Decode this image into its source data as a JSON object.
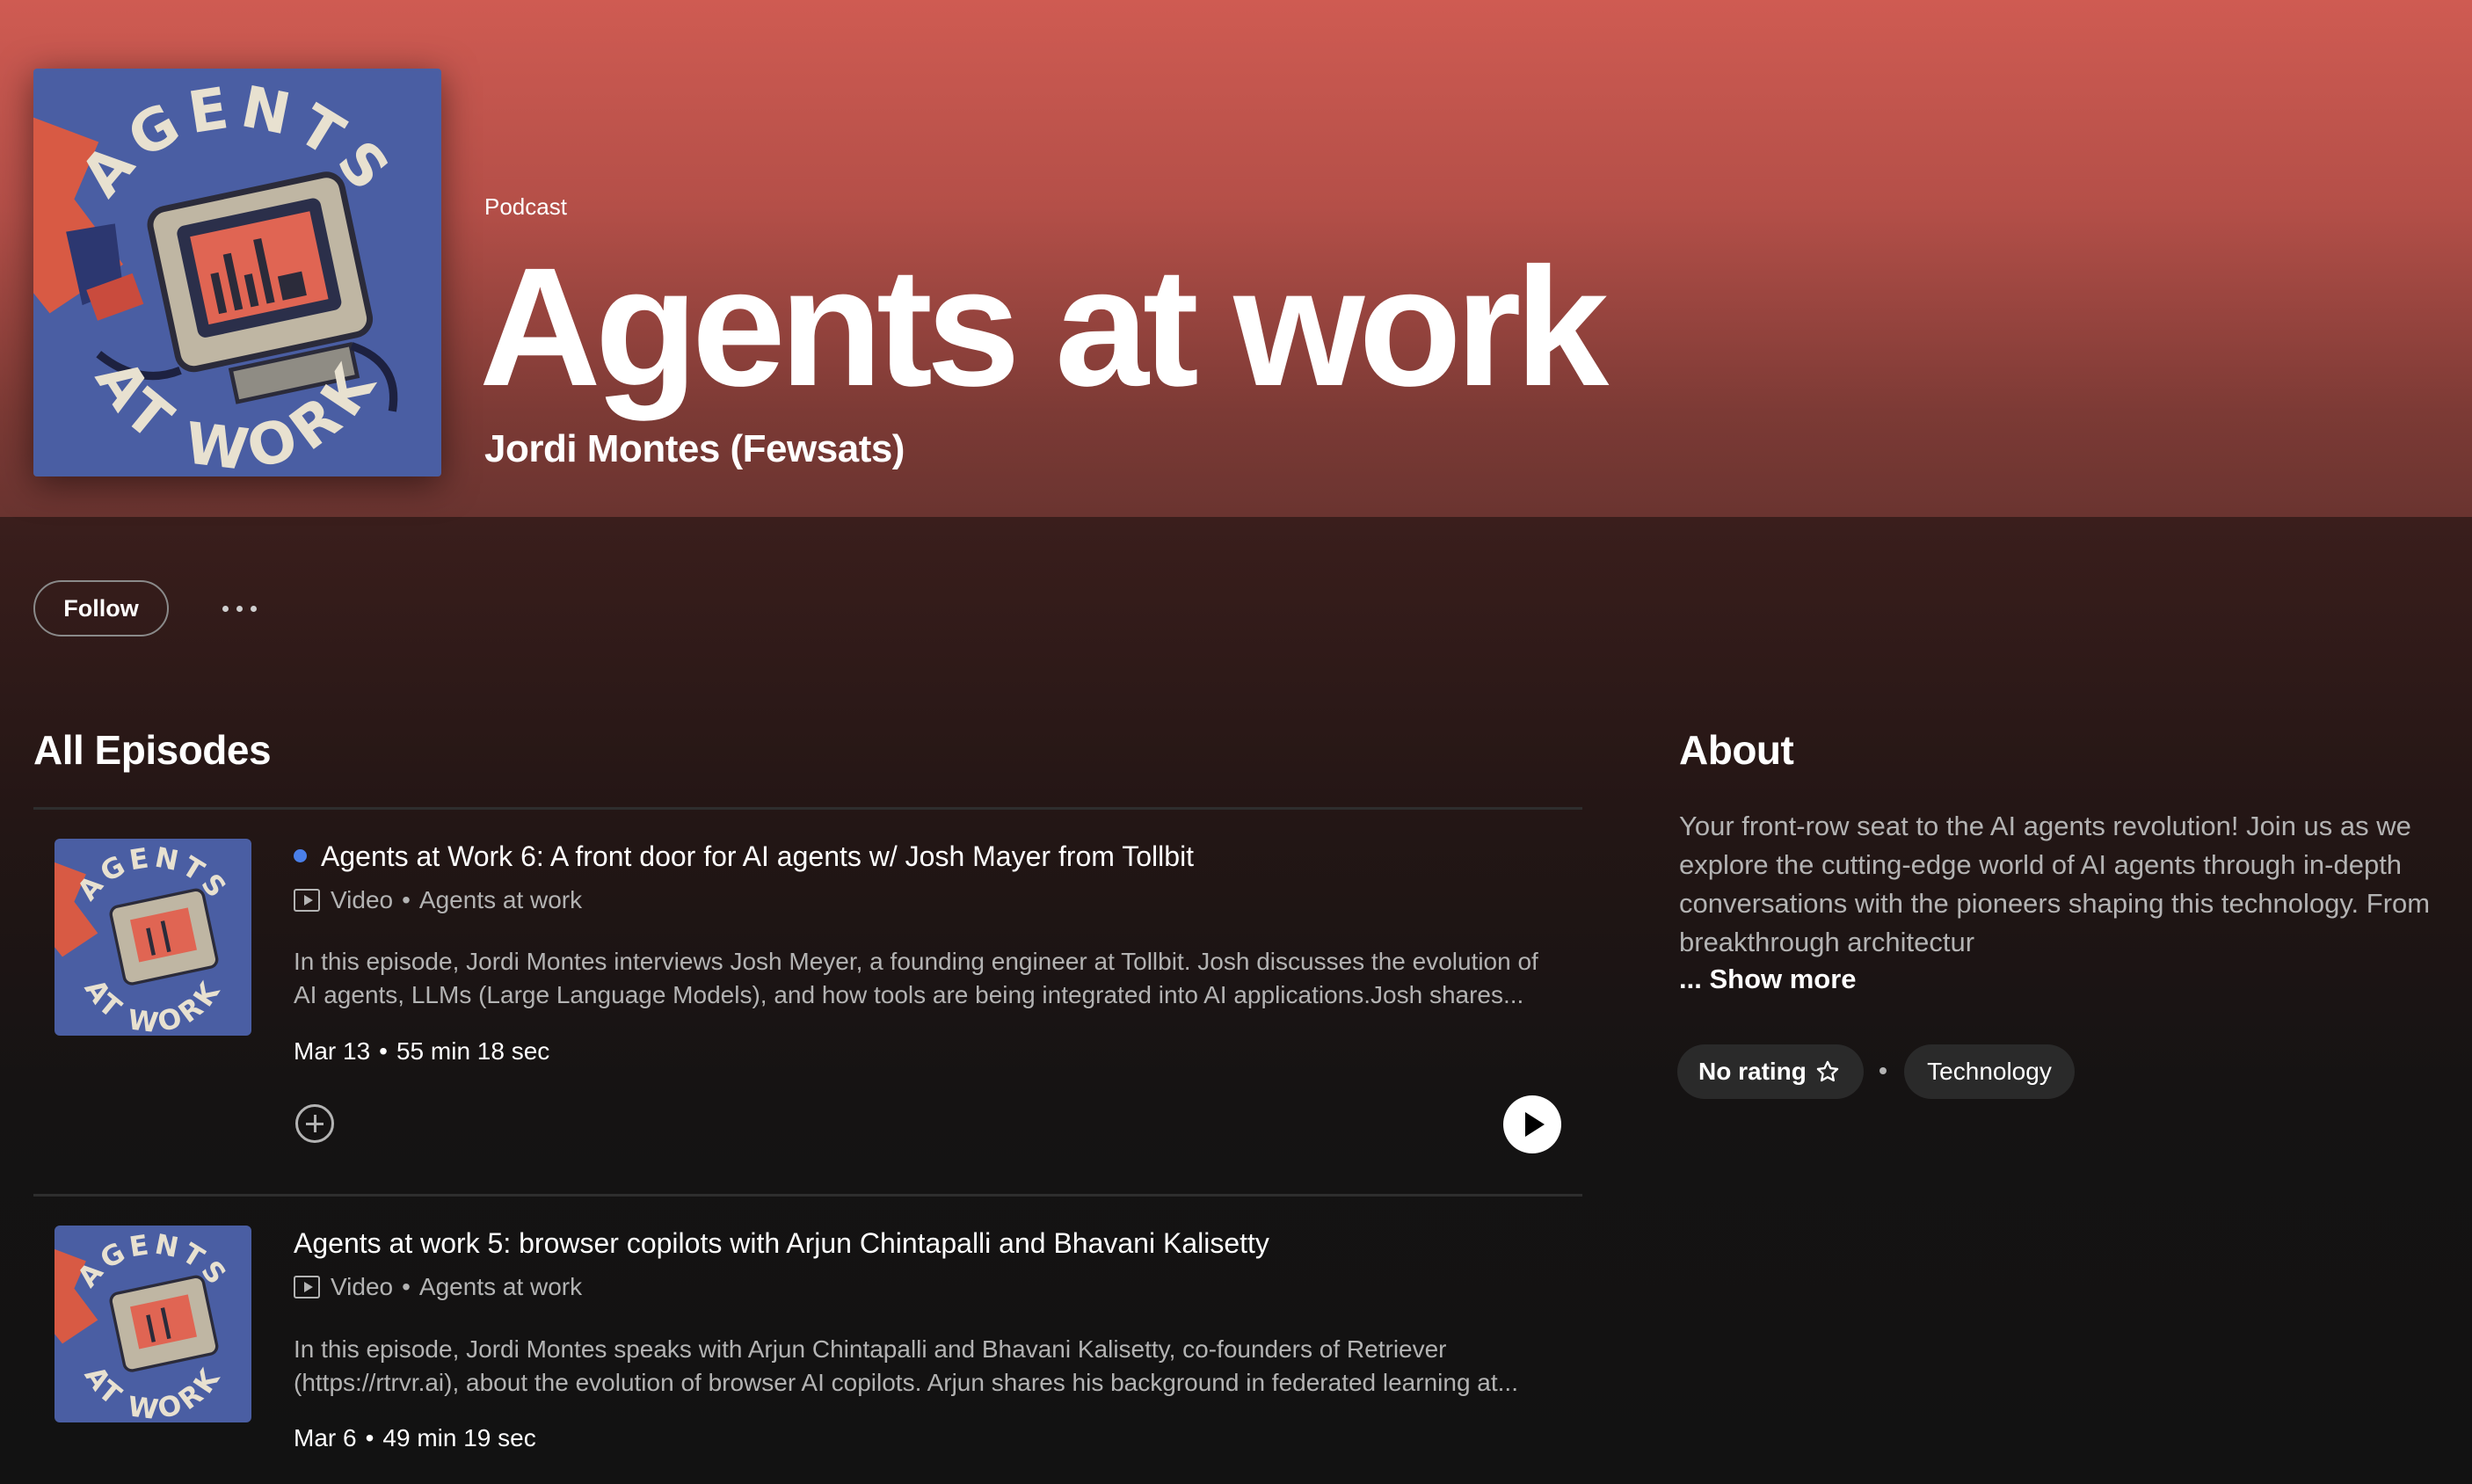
{
  "header": {
    "type_label": "Podcast",
    "title": "Agents at work",
    "author": "Jordi Montes (Fewsats)",
    "cover_text_top": "AGENTS",
    "cover_text_bottom": "AT WORK"
  },
  "actions": {
    "follow_label": "Follow",
    "more_icon": "more-horizontal-icon"
  },
  "episodes_section": {
    "title": "All Episodes",
    "episodes": [
      {
        "title": "Agents at Work 6: A front door for AI agents w/ Josh Mayer from Tollbit",
        "is_new": true,
        "media_type": "Video",
        "show": "Agents at work",
        "description": "In this episode, Jordi Montes interviews Josh Meyer, a founding engineer at Tollbit. Josh discusses the evolution of AI agents, LLMs (Large Language Models), and how tools are being integrated into AI applications.Josh shares...",
        "date": "Mar 13",
        "duration": "55 min 18 sec"
      },
      {
        "title": "Agents at work 5: browser copilots with Arjun Chintapalli and Bhavani Kalisetty",
        "is_new": false,
        "media_type": "Video",
        "show": "Agents at work",
        "description": "In this episode, Jordi Montes speaks with Arjun Chintapalli and Bhavani Kalisetty, co-founders of Retriever (https://rtrvr.ai), about the evolution of browser AI copilots. Arjun shares his background in federated learning at...",
        "date": "Mar 6",
        "duration": "49 min 19 sec"
      }
    ]
  },
  "about": {
    "title": "About",
    "text": "Your front-row seat to the AI agents revolution! Join us as we explore the cutting-edge world of AI agents through in-depth conversations with the pioneers shaping this technology. From breakthrough architectur",
    "show_more": "... Show more",
    "rating_label": "No rating",
    "category": "Technology"
  },
  "colors": {
    "hero_top": "#cf5b52",
    "background": "#121212",
    "new_dot": "#4a7fe8",
    "cover_blue": "#4a5ea3"
  }
}
